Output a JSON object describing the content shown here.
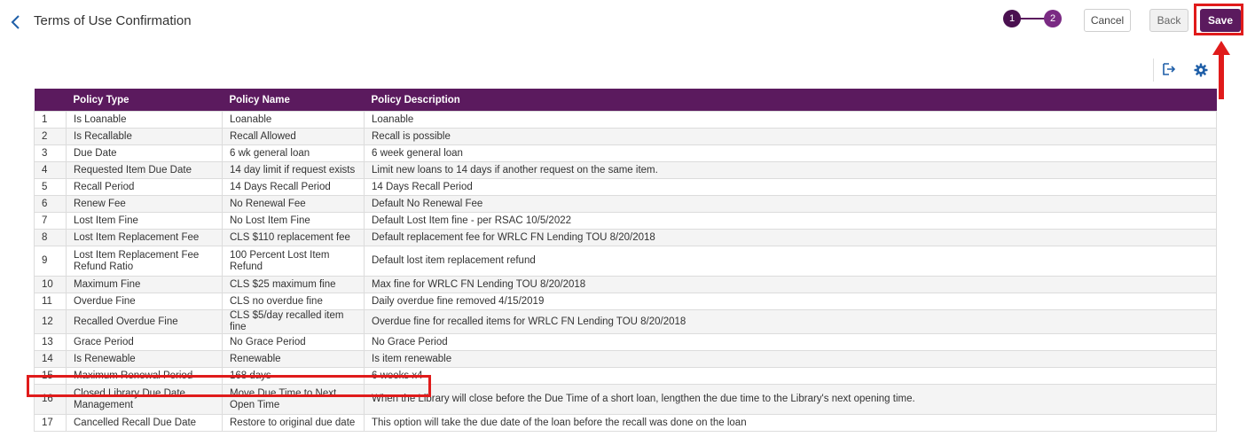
{
  "header": {
    "title": "Terms of Use Confirmation",
    "back_icon": "chevron-left-icon",
    "steps": [
      {
        "label": "1"
      },
      {
        "label": "2"
      }
    ],
    "buttons": {
      "cancel": "Cancel",
      "back": "Back",
      "save": "Save"
    }
  },
  "toolbar": {
    "export_icon": "export-icon",
    "settings_icon": "gear-icon"
  },
  "colors": {
    "brand": "#5b1a5e",
    "highlight": "#e01b1b"
  },
  "table": {
    "columns": [
      "",
      "Policy Type",
      "Policy Name",
      "Policy Description"
    ],
    "rows": [
      {
        "num": "1",
        "type": "Is Loanable",
        "name": "Loanable",
        "description": "Loanable"
      },
      {
        "num": "2",
        "type": "Is Recallable",
        "name": "Recall Allowed",
        "description": "Recall is possible"
      },
      {
        "num": "3",
        "type": "Due Date",
        "name": "6 wk general loan",
        "description": "6 week general loan"
      },
      {
        "num": "4",
        "type": "Requested Item Due Date",
        "name": "14 day limit if request exists",
        "description": "Limit new loans to 14 days if another request on the same item."
      },
      {
        "num": "5",
        "type": "Recall Period",
        "name": "14 Days Recall Period",
        "description": "14 Days Recall Period"
      },
      {
        "num": "6",
        "type": "Renew Fee",
        "name": "No Renewal Fee",
        "description": "Default No Renewal Fee"
      },
      {
        "num": "7",
        "type": "Lost Item Fine",
        "name": "No Lost Item Fine",
        "description": "Default Lost Item fine - per RSAC 10/5/2022"
      },
      {
        "num": "8",
        "type": "Lost Item Replacement Fee",
        "name": "CLS $110 replacement fee",
        "description": "Default replacement fee for WRLC FN Lending TOU 8/20/2018"
      },
      {
        "num": "9",
        "type": "Lost Item Replacement Fee Refund Ratio",
        "name": "100 Percent Lost Item Refund",
        "description": "Default lost item replacement refund"
      },
      {
        "num": "10",
        "type": "Maximum Fine",
        "name": "CLS $25 maximum fine",
        "description": "Max fine for WRLC FN Lending TOU 8/20/2018"
      },
      {
        "num": "11",
        "type": "Overdue Fine",
        "name": "CLS no overdue fine",
        "description": "Daily overdue fine removed 4/15/2019"
      },
      {
        "num": "12",
        "type": "Recalled Overdue Fine",
        "name": "CLS $5/day recalled item fine",
        "description": "Overdue fine for recalled items for WRLC FN Lending TOU 8/20/2018"
      },
      {
        "num": "13",
        "type": "Grace Period",
        "name": "No Grace Period",
        "description": "No Grace Period"
      },
      {
        "num": "14",
        "type": "Is Renewable",
        "name": "Renewable",
        "description": "Is item renewable"
      },
      {
        "num": "15",
        "type": "Maximum Renewal Period",
        "name": "168 days",
        "description": "6 weeks x4"
      },
      {
        "num": "16",
        "type": "Closed Library Due Date Management",
        "name": "Move Due Time to Next Open Time",
        "description": "When the Library will close before the Due Time of a short loan, lengthen the due time to the Library's next opening time."
      },
      {
        "num": "17",
        "type": "Cancelled Recall Due Date",
        "name": "Restore to original due date",
        "description": "This option will take the due date of the loan before the recall was done on the loan"
      }
    ]
  }
}
